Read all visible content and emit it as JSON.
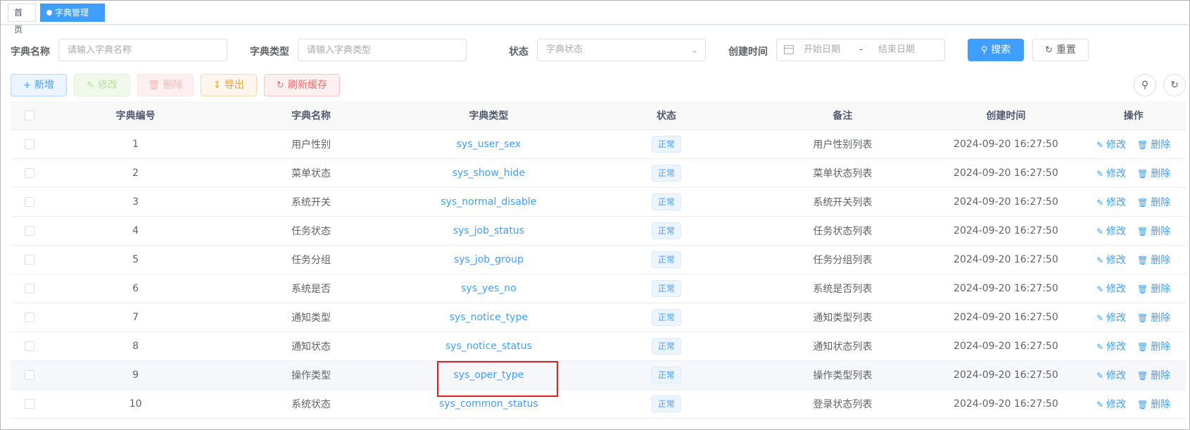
{
  "tags": {
    "home": "首页",
    "active": "字典管理",
    "close": "×"
  },
  "search": {
    "dict_name_label": "字典名称",
    "dict_name_placeholder": "请输入字典名称",
    "dict_type_label": "字典类型",
    "dict_type_placeholder": "请输入字典类型",
    "status_label": "状态",
    "status_placeholder": "字典状态",
    "created_label": "创建时间",
    "start_date_placeholder": "开始日期",
    "date_separator": "-",
    "end_date_placeholder": "结束日期",
    "search_button": "搜索",
    "reset_button": "重置"
  },
  "toolbar": {
    "add": "新增",
    "edit": "修改",
    "delete": "删除",
    "export": "导出",
    "refresh_cache": "刷新缓存"
  },
  "table": {
    "headers": [
      "字典编号",
      "字典名称",
      "字典类型",
      "状态",
      "备注",
      "创建时间",
      "操作"
    ],
    "rows": [
      {
        "id": "1",
        "name": "用户性别",
        "type": "sys_user_sex",
        "status": "正常",
        "remark": "用户性别列表",
        "created": "2024-09-20 16:27:50"
      },
      {
        "id": "2",
        "name": "菜单状态",
        "type": "sys_show_hide",
        "status": "正常",
        "remark": "菜单状态列表",
        "created": "2024-09-20 16:27:50"
      },
      {
        "id": "3",
        "name": "系统开关",
        "type": "sys_normal_disable",
        "status": "正常",
        "remark": "系统开关列表",
        "created": "2024-09-20 16:27:50"
      },
      {
        "id": "4",
        "name": "任务状态",
        "type": "sys_job_status",
        "status": "正常",
        "remark": "任务状态列表",
        "created": "2024-09-20 16:27:50"
      },
      {
        "id": "5",
        "name": "任务分组",
        "type": "sys_job_group",
        "status": "正常",
        "remark": "任务分组列表",
        "created": "2024-09-20 16:27:50"
      },
      {
        "id": "6",
        "name": "系统是否",
        "type": "sys_yes_no",
        "status": "正常",
        "remark": "系统是否列表",
        "created": "2024-09-20 16:27:50"
      },
      {
        "id": "7",
        "name": "通知类型",
        "type": "sys_notice_type",
        "status": "正常",
        "remark": "通知类型列表",
        "created": "2024-09-20 16:27:50"
      },
      {
        "id": "8",
        "name": "通知状态",
        "type": "sys_notice_status",
        "status": "正常",
        "remark": "通知状态列表",
        "created": "2024-09-20 16:27:50"
      },
      {
        "id": "9",
        "name": "操作类型",
        "type": "sys_oper_type",
        "status": "正常",
        "remark": "操作类型列表",
        "created": "2024-09-20 16:27:50"
      },
      {
        "id": "10",
        "name": "系统状态",
        "type": "sys_common_status",
        "status": "正常",
        "remark": "登录状态列表",
        "created": "2024-09-20 16:27:50"
      }
    ],
    "row_actions": {
      "edit": "修改",
      "delete": "删除"
    }
  },
  "colors": {
    "primary": "#409eff",
    "highlight_box": "#e02020"
  }
}
